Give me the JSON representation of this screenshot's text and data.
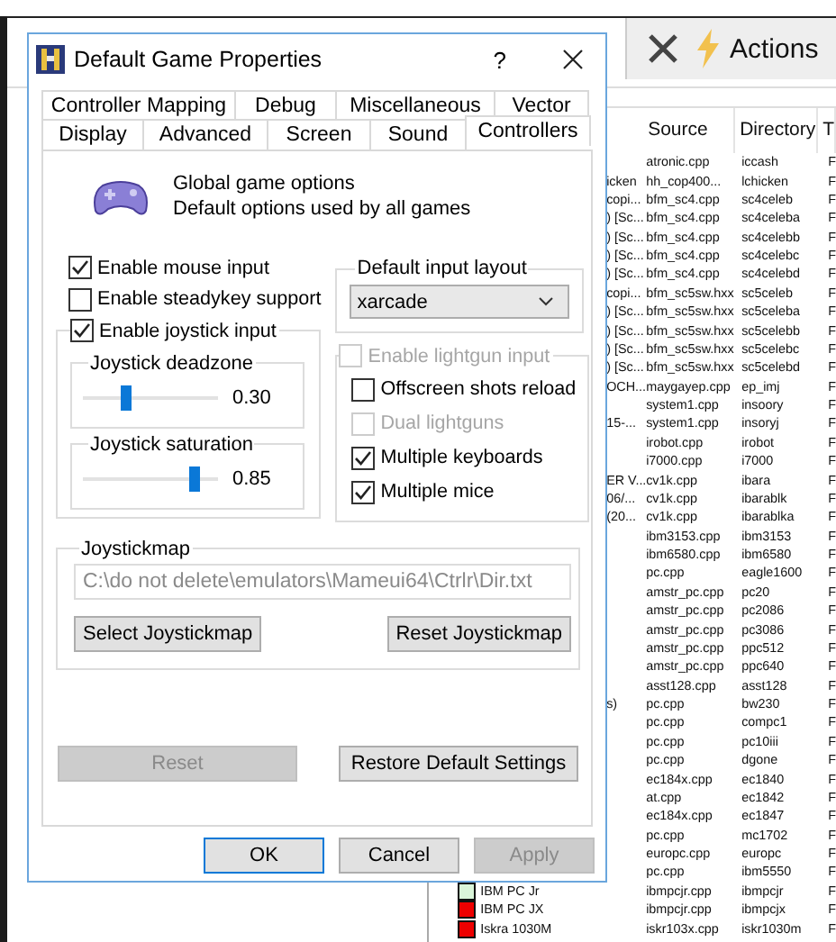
{
  "background_app": {
    "toolbar": {
      "actions_label": "Actions"
    },
    "list": {
      "columns": [
        "Source",
        "Directory",
        "T"
      ],
      "rows": [
        {
          "source": "atronic.cpp",
          "directory": "iccash",
          "column_4": "F"
        },
        {
          "column_1": "icken",
          "source": "hh_cop400...",
          "directory": "lchicken",
          "column_4": "F"
        },
        {
          "column_1": "copi...",
          "source": "bfm_sc4.cpp",
          "directory": "sc4celeb",
          "column_4": "F"
        },
        {
          "column_1": ") [Sc...",
          "source": "bfm_sc4.cpp",
          "directory": "sc4celeba",
          "column_4": "F"
        },
        {
          "column_1": ") [Sc...",
          "source": "bfm_sc4.cpp",
          "directory": "sc4celebb",
          "column_4": "F"
        },
        {
          "column_1": ") [Sc...",
          "source": "bfm_sc4.cpp",
          "directory": "sc4celebc",
          "column_4": "F"
        },
        {
          "column_1": ") [Sc...",
          "source": "bfm_sc4.cpp",
          "directory": "sc4celebd",
          "column_4": "F"
        },
        {
          "column_1": "copi...",
          "source": "bfm_sc5sw.hxx",
          "directory": "sc5celeb",
          "column_4": "F"
        },
        {
          "column_1": ") [Sc...",
          "source": "bfm_sc5sw.hxx",
          "directory": "sc5celeba",
          "column_4": "F"
        },
        {
          "column_1": ") [Sc...",
          "source": "bfm_sc5sw.hxx",
          "directory": "sc5celebb",
          "column_4": "F"
        },
        {
          "column_1": ") [Sc...",
          "source": "bfm_sc5sw.hxx",
          "directory": "sc5celebc",
          "column_4": "F"
        },
        {
          "column_1": ") [Sc...",
          "source": "bfm_sc5sw.hxx",
          "directory": "sc5celebd",
          "column_4": "F"
        },
        {
          "column_1": "OCH...",
          "source": "maygayep.cpp",
          "directory": "ep_imj",
          "column_4": "F"
        },
        {
          "source": "system1.cpp",
          "directory": "insoory",
          "column_4": "F"
        },
        {
          "column_1": "15-...",
          "source": "system1.cpp",
          "directory": "insoryj",
          "column_4": "F"
        },
        {
          "source": "irobot.cpp",
          "directory": "irobot",
          "column_4": "F"
        },
        {
          "source": "i7000.cpp",
          "directory": "i7000",
          "column_4": "F"
        },
        {
          "column_1": "ER V...",
          "source": "cv1k.cpp",
          "directory": "ibara",
          "column_4": "F"
        },
        {
          "column_1": "06/...",
          "source": "cv1k.cpp",
          "directory": "ibarablk",
          "column_4": "F"
        },
        {
          "column_1": "(20...",
          "source": "cv1k.cpp",
          "directory": "ibarablka",
          "column_4": "F"
        },
        {
          "source": "ibm3153.cpp",
          "directory": "ibm3153",
          "column_4": "F"
        },
        {
          "source": "ibm6580.cpp",
          "directory": "ibm6580",
          "column_4": "F"
        },
        {
          "source": "pc.cpp",
          "directory": "eagle1600",
          "column_4": "F"
        },
        {
          "source": "amstr_pc.cpp",
          "directory": "pc20",
          "column_4": "F"
        },
        {
          "source": "amstr_pc.cpp",
          "directory": "pc2086",
          "column_4": "F"
        },
        {
          "source": "amstr_pc.cpp",
          "directory": "pc3086",
          "column_4": "F"
        },
        {
          "source": "amstr_pc.cpp",
          "directory": "ppc512",
          "column_4": "F"
        },
        {
          "source": "amstr_pc.cpp",
          "directory": "ppc640",
          "column_4": "F"
        },
        {
          "source": "asst128.cpp",
          "directory": "asst128",
          "column_4": "F"
        },
        {
          "column_1": "s)",
          "source": "pc.cpp",
          "directory": "bw230",
          "column_4": "F"
        },
        {
          "source": "pc.cpp",
          "directory": "compc1",
          "column_4": "F"
        },
        {
          "source": "pc.cpp",
          "directory": "pc10iii",
          "column_4": "F"
        },
        {
          "source": "pc.cpp",
          "directory": "dgone",
          "column_4": "F"
        },
        {
          "source": "ec184x.cpp",
          "directory": "ec1840",
          "column_4": "F"
        },
        {
          "source": "at.cpp",
          "directory": "ec1842",
          "column_4": "F"
        },
        {
          "source": "ec184x.cpp",
          "directory": "ec1847",
          "column_4": "F"
        },
        {
          "source": "pc.cpp",
          "directory": "mc1702",
          "column_4": "F"
        },
        {
          "source": "europc.cpp",
          "directory": "europc",
          "column_4": "F"
        },
        {
          "source": "pc.cpp",
          "directory": "ibm5550",
          "column_4": "F"
        },
        {
          "name": "IBM PC Jr",
          "color": "#d9f5d9",
          "source": "ibmpcjr.cpp",
          "directory": "ibmpcjr",
          "column_4": "F"
        },
        {
          "name": "IBM PC JX",
          "color": "#ee0000",
          "source": "ibmpcjr.cpp",
          "directory": "ibmpcjx",
          "column_4": "F"
        },
        {
          "name": "Iskra 1030M",
          "color": "#ee0000",
          "source": "iskr103x.cpp",
          "directory": "iskr1030m",
          "column_4": "F"
        }
      ]
    }
  },
  "dialog": {
    "title": "Default Game Properties",
    "help": "?",
    "tabs_row_1": [
      {
        "label": "Controller Mapping",
        "selected": false
      },
      {
        "label": "Debug",
        "selected": false
      },
      {
        "label": "Miscellaneous",
        "selected": false
      },
      {
        "label": "Vector",
        "selected": false
      }
    ],
    "tabs_row_2": [
      {
        "label": "Display",
        "selected": false
      },
      {
        "label": "Advanced",
        "selected": false
      },
      {
        "label": "Screen",
        "selected": false
      },
      {
        "label": "Sound",
        "selected": false
      },
      {
        "label": "Controllers",
        "selected": true
      }
    ],
    "header": {
      "title": "Global game options",
      "subtitle": "Default options used by all games"
    },
    "options_left": [
      {
        "label": "Enable mouse input",
        "checked": true
      },
      {
        "label": "Enable steadykey support",
        "checked": false
      }
    ],
    "joystick_group": {
      "label": "Enable joystick input",
      "checked": true,
      "sliders": [
        {
          "label": "Joystick deadzone",
          "level": 0.3,
          "reading": "0.30"
        },
        {
          "label": "Joystick saturation",
          "level": 0.85,
          "reading": "0.85"
        }
      ]
    },
    "input_layout": {
      "label": "Default input layout",
      "value": "xarcade"
    },
    "lightgun_group": {
      "label": "Enable lightgun input",
      "checked": false,
      "disabled": true,
      "options": [
        {
          "label": "Offscreen shots reload",
          "checked": false,
          "disabled": false
        },
        {
          "label": "Dual lightguns",
          "checked": false,
          "disabled": true
        },
        {
          "label": "Multiple keyboards",
          "checked": true,
          "disabled": false
        },
        {
          "label": "Multiple mice",
          "checked": true,
          "disabled": false
        }
      ]
    },
    "joystickmap": {
      "label": "Joystickmap",
      "path": "C:\\do not delete\\emulators\\Mameui64\\Ctrlr\\Dir.txt",
      "buttons": [
        "Select Joystickmap",
        "Reset Joystickmap"
      ]
    },
    "panel_buttons": [
      {
        "label": "Reset",
        "disabled": true
      },
      {
        "label": "Restore Default Settings",
        "disabled": false
      }
    ],
    "footer_buttons": [
      {
        "label": "OK",
        "default": true,
        "disabled": false
      },
      {
        "label": "Cancel",
        "default": false,
        "disabled": false
      },
      {
        "label": "Apply",
        "default": false,
        "disabled": true
      }
    ]
  }
}
